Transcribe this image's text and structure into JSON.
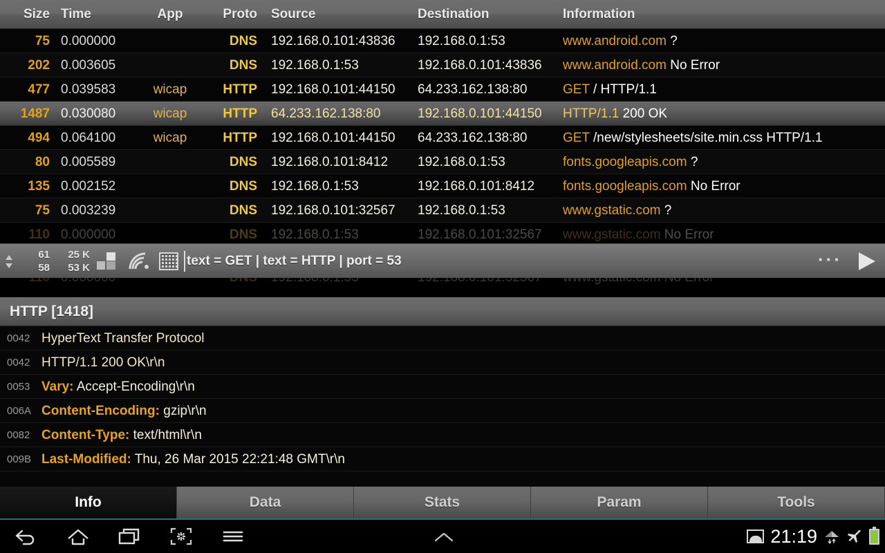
{
  "table": {
    "columns": [
      "Size",
      "Time",
      "App",
      "Proto",
      "Source",
      "Destination",
      "Information"
    ],
    "rows": [
      {
        "size": "75",
        "time": "0.000000",
        "app": "",
        "proto": "DNS",
        "src": "192.168.0.101:43836",
        "dst": "192.168.0.1:53",
        "info_hl": "www.android.com",
        "info_rest": " ?"
      },
      {
        "size": "202",
        "time": "0.003605",
        "app": "",
        "proto": "DNS",
        "src": "192.168.0.1:53",
        "dst": "192.168.0.101:43836",
        "info_hl": "www.android.com",
        "info_rest": " No Error"
      },
      {
        "size": "477",
        "time": "0.039583",
        "app": "wicap",
        "proto": "HTTP",
        "src": "192.168.0.101:44150",
        "dst": "64.233.162.138:80",
        "info_hl": "GET",
        "info_rest": " / HTTP/1.1"
      },
      {
        "size": "1487",
        "time": "0.030080",
        "app": "wicap",
        "proto": "HTTP",
        "src": "64.233.162.138:80",
        "dst": "192.168.0.101:44150",
        "info_hl": "HTTP/1.1",
        "info_rest": " 200 OK"
      },
      {
        "size": "494",
        "time": "0.064100",
        "app": "wicap",
        "proto": "HTTP",
        "src": "192.168.0.101:44150",
        "dst": "64.233.162.138:80",
        "info_hl": "GET",
        "info_rest": " /new/stylesheets/site.min.css HTTP/1.1"
      },
      {
        "size": "80",
        "time": "0.005589",
        "app": "",
        "proto": "DNS",
        "src": "192.168.0.101:8412",
        "dst": "192.168.0.1:53",
        "info_hl": "fonts.googleapis.com",
        "info_rest": " ?"
      },
      {
        "size": "135",
        "time": "0.002152",
        "app": "",
        "proto": "DNS",
        "src": "192.168.0.1:53",
        "dst": "192.168.0.101:8412",
        "info_hl": "fonts.googleapis.com",
        "info_rest": " No Error"
      },
      {
        "size": "75",
        "time": "0.003239",
        "app": "",
        "proto": "DNS",
        "src": "192.168.0.101:32567",
        "dst": "192.168.0.1:53",
        "info_hl": "www.gstatic.com",
        "info_rest": " ?"
      },
      {
        "size": "110",
        "time": "0.000000",
        "app": "",
        "proto": "DNS",
        "src": "192.168.0.1:53",
        "dst": "192.168.0.101:32567",
        "info_hl": "www.gstatic.com",
        "info_rest": " No Error"
      }
    ],
    "selected_row_index": 3
  },
  "toolbar": {
    "packets_up": "61",
    "packets_down": "58",
    "bytes_up": "25 K",
    "bytes_down": "53 K",
    "filter_value": "text = GET | text = HTTP | port = 53",
    "more_label": "···",
    "icons": [
      "grid4-icon",
      "wifi-icon",
      "matrix-icon",
      "overflow-menu-icon",
      "play-icon"
    ]
  },
  "detail": {
    "title": "HTTP [1418]",
    "rows": [
      {
        "offset": "0042",
        "key": "",
        "value": "HyperText Transfer Protocol",
        "style": "plain"
      },
      {
        "offset": "0042",
        "key": "",
        "value": "HTTP/1.1 200 OK\\r\\n",
        "style": "plain"
      },
      {
        "offset": "0053",
        "key": "Vary:",
        "value": " Accept-Encoding\\r\\n",
        "style": "kv"
      },
      {
        "offset": "006A",
        "key": "Content-Encoding:",
        "value": " gzip\\r\\n",
        "style": "kv"
      },
      {
        "offset": "0082",
        "key": "Content-Type:",
        "value": " text/html\\r\\n",
        "style": "kv"
      },
      {
        "offset": "009B",
        "key": "Last-Modified:",
        "value": " Thu, 26 Mar 2015 22:21:48 GMT\\r\\n",
        "style": "kv"
      }
    ]
  },
  "tabs": {
    "items": [
      {
        "label": "Info",
        "active": true
      },
      {
        "label": "Data",
        "active": false
      },
      {
        "label": "Stats",
        "active": false
      },
      {
        "label": "Param",
        "active": false
      },
      {
        "label": "Tools",
        "active": false
      }
    ],
    "accent_color": "#2b6b7a"
  },
  "navbar": {
    "buttons": [
      "back-icon",
      "home-icon",
      "recents-icon",
      "screenshot-icon",
      "menu-icon",
      "chevron-up-icon"
    ],
    "clock": "21:19",
    "status_icons": [
      "image-icon",
      "wifi-signal-icon",
      "airplane-mode-icon",
      "battery-icon"
    ],
    "battery_color": "#8cc63f"
  },
  "colors": {
    "accent_orange": "#e0a21a",
    "proto_yellow": "#f0c93c",
    "key_orange": "#e8a317",
    "tab_underline": "#2b6b7a"
  }
}
